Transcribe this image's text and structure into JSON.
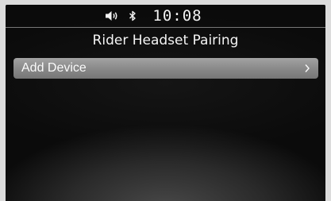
{
  "status_bar": {
    "volume_icon": "speaker-volume-icon",
    "bluetooth_icon": "bluetooth-icon",
    "time": "10:08"
  },
  "screen": {
    "title": "Rider Headset Pairing"
  },
  "menu": {
    "items": [
      {
        "label": "Add Device",
        "icon": "chevron-right-icon"
      }
    ]
  },
  "colors": {
    "background": "#0c0c0c",
    "text": "#f4f4f4",
    "highlight": "#8a8a8a"
  }
}
